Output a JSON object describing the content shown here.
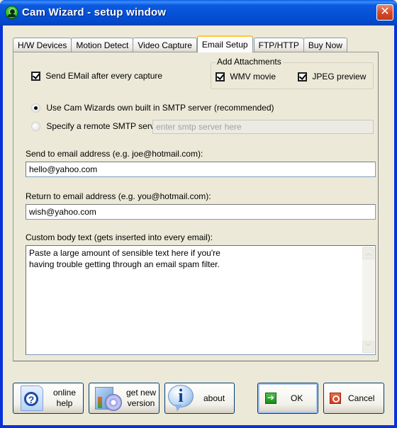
{
  "window": {
    "title": "Cam Wizard - setup window",
    "close_glyph": "✕"
  },
  "tabs": [
    {
      "label": "H/W Devices",
      "active": false
    },
    {
      "label": "Motion Detect",
      "active": false
    },
    {
      "label": "Video Capture",
      "active": false
    },
    {
      "label": "Email Setup",
      "active": true
    },
    {
      "label": "FTP/HTTP",
      "active": false
    },
    {
      "label": "Buy Now",
      "active": false
    }
  ],
  "email_setup": {
    "send_after_capture": {
      "label": "Send EMail after every capture",
      "checked": true
    },
    "attachments": {
      "title": "Add Attachments",
      "wmv": {
        "label": "WMV movie",
        "checked": true
      },
      "jpeg": {
        "label": "JPEG preview",
        "checked": true
      }
    },
    "smtp": {
      "builtin_label": "Use Cam Wizards own built in SMTP server (recommended)",
      "builtin_selected": true,
      "remote_label": "Specify a remote SMTP server:",
      "remote_selected": false,
      "remote_placeholder": "enter smtp server here"
    },
    "send_to": {
      "label": "Send to email address (e.g. joe@hotmail.com):",
      "value": "hello@yahoo.com"
    },
    "return_to": {
      "label": "Return to email address (e.g. you@hotmail.com):",
      "value": "wish@yahoo.com"
    },
    "body": {
      "label": "Custom body text (gets inserted into every email):",
      "value": "Paste a large amount of sensible text here if you're\nhaving trouble getting through an email spam filter."
    }
  },
  "buttons": {
    "online_help": "online\nhelp",
    "get_new_version": "get new\nversion",
    "about": "about",
    "ok": "OK",
    "cancel": "Cancel"
  },
  "icons": {
    "ok_glyph": "➔",
    "scroll_up": "︿",
    "scroll_down": "﹀",
    "info_glyph": "i"
  }
}
